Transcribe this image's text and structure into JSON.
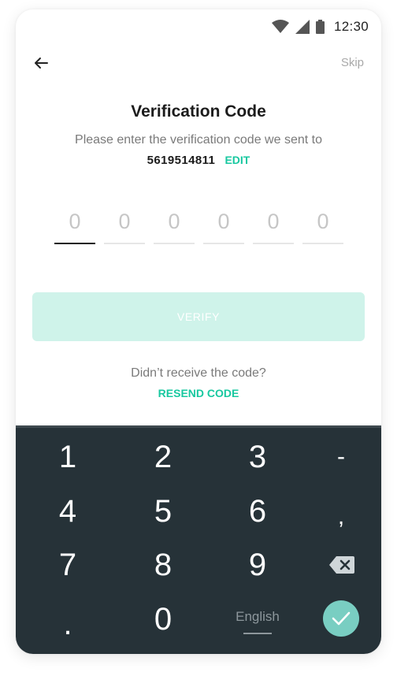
{
  "status_bar": {
    "time": "12:30",
    "icons": [
      "wifi-icon",
      "cell-signal-icon",
      "battery-icon"
    ]
  },
  "header": {
    "back_icon": "arrow-left-icon",
    "skip_label": "Skip"
  },
  "verification": {
    "title": "Verification Code",
    "subtitle": "Please enter the verification code we sent to",
    "phone_number": "5619514811",
    "edit_label": "EDIT",
    "code_digits": [
      "0",
      "0",
      "0",
      "0",
      "0",
      "0"
    ],
    "verify_label": "VERIFY",
    "resend_prompt": "Didn’t receive the code?",
    "resend_label": "RESEND CODE"
  },
  "keyboard": {
    "row1": [
      "1",
      "2",
      "3",
      "-"
    ],
    "row2": [
      "4",
      "5",
      "6",
      ","
    ],
    "row3": [
      "7",
      "8",
      "9"
    ],
    "row4": [
      ".",
      "0"
    ],
    "language": "English",
    "backspace_icon": "backspace-icon",
    "enter_icon": "checkmark-icon"
  },
  "colors": {
    "accent": "#18c8a0",
    "button_disabled": "#cff3ea",
    "keyboard_bg": "#263238",
    "enter_key": "#79cec2"
  }
}
